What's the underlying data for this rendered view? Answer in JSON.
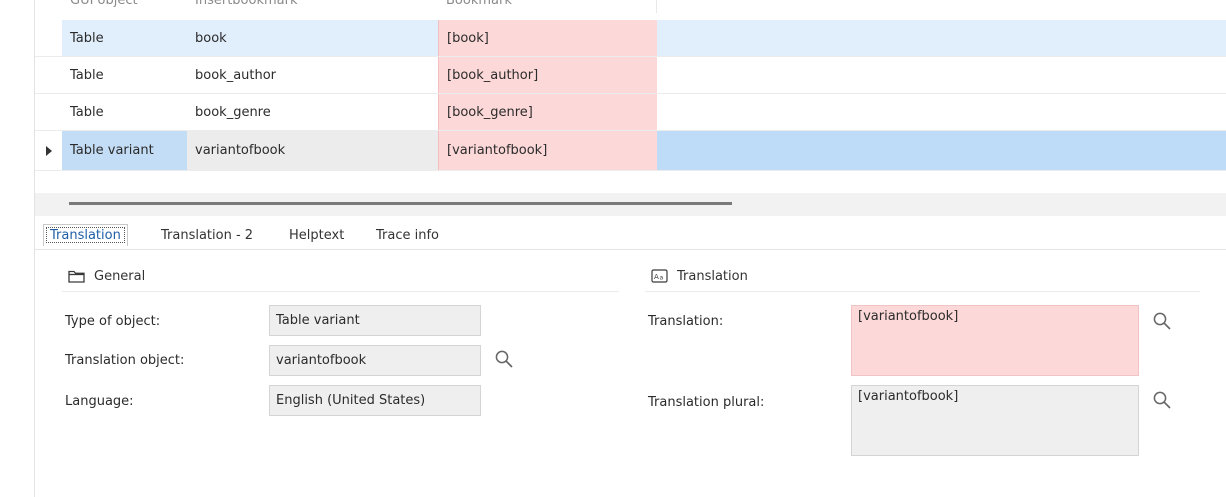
{
  "grid": {
    "columns": [
      "GUI object",
      "Insertbookmark",
      "Bookmark"
    ],
    "rows": [
      {
        "gui_object": "Table",
        "insert_bookmark": "book",
        "bookmark": "[book]"
      },
      {
        "gui_object": "Table",
        "insert_bookmark": "book_author",
        "bookmark": "[book_author]"
      },
      {
        "gui_object": "Table",
        "insert_bookmark": "book_genre",
        "bookmark": "[book_genre]"
      },
      {
        "gui_object": "Table variant",
        "insert_bookmark": "variantofbook",
        "bookmark": "[variantofbook]"
      }
    ]
  },
  "tabs": [
    "Translation",
    "Translation - 2",
    "Helptext",
    "Trace info"
  ],
  "general": {
    "title": "General",
    "icon": "folder-icon",
    "type_of_object_label": "Type of object:",
    "type_of_object_value": "Table variant",
    "translation_object_label": "Translation object:",
    "translation_object_value": "variantofbook",
    "language_label": "Language:",
    "language_value": "English (United States)"
  },
  "translation": {
    "title": "Translation",
    "icon": "translate-icon",
    "translation_label": "Translation:",
    "translation_value": "[variantofbook]",
    "translation_plural_label": "Translation plural:",
    "translation_plural_value": "[variantofbook]"
  },
  "colors": {
    "selected_row": "#e1eefb",
    "current_row": "#bedcf7",
    "bookmark_highlight": "#fdd8d8",
    "active_tab_text": "#1f5fa8"
  }
}
